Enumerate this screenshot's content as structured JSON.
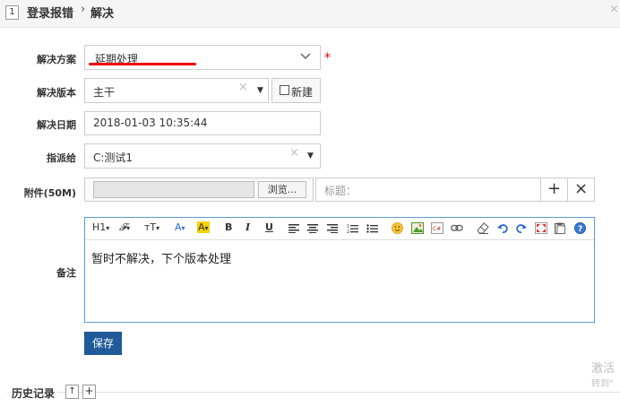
{
  "header": {
    "id": "1",
    "title": "登录报错",
    "separator": "›",
    "subtitle": "解决",
    "close": "×"
  },
  "form": {
    "solution": {
      "label": "解决方案",
      "value": "延期处理",
      "required": "*"
    },
    "version": {
      "label": "解决版本",
      "value": "主干",
      "new_label": "新建"
    },
    "date": {
      "label": "解决日期",
      "value": "2018-01-03 10:35:44"
    },
    "assign": {
      "label": "指派给",
      "value": "C:测试1"
    },
    "attachment": {
      "label": "附件(50M)",
      "browse": "浏览...",
      "title_placeholder": "标题：",
      "add": "+",
      "remove": "×"
    },
    "comment": {
      "label": "备注",
      "content": "暂时不解决，下个版本处理"
    }
  },
  "toolbar": {
    "h1": "H1",
    "font": "𝓕",
    "size": "тT",
    "font_color": "A",
    "bg_color": "A",
    "bold": "B",
    "italic": "I",
    "underline": "U"
  },
  "save_label": "保存",
  "history": {
    "title": "历史记录",
    "up": "↑",
    "expand": "+"
  },
  "watermark": {
    "line1": "激活",
    "line2": "转到\""
  },
  "colors": {
    "accent": "#1f5a99",
    "required": "#e00000",
    "editor_border": "#5b9bd5"
  }
}
